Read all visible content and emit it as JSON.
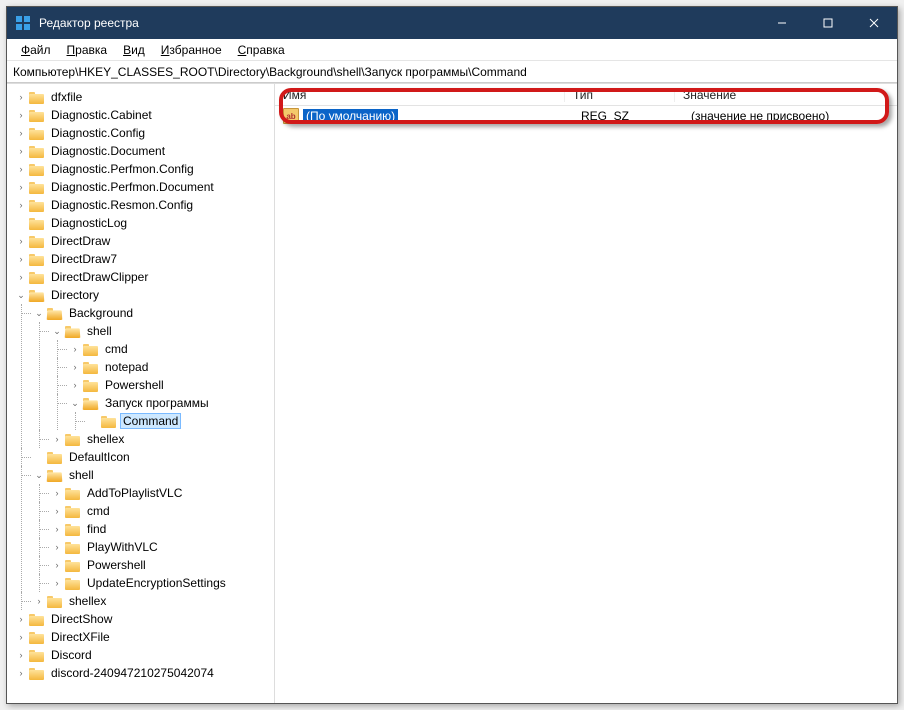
{
  "window": {
    "title": "Редактор реестра"
  },
  "menubar": [
    "Файл",
    "Правка",
    "Вид",
    "Избранное",
    "Справка"
  ],
  "addressbar": "Компьютер\\HKEY_CLASSES_ROOT\\Directory\\Background\\shell\\Запуск программы\\Command",
  "list": {
    "columns": {
      "name": "Имя",
      "type": "Тип",
      "data": "Значение"
    },
    "rows": [
      {
        "name": "(По умолчанию)",
        "type": "REG_SZ",
        "data": "(значение не присвоено)",
        "selected": true
      }
    ]
  },
  "tree": [
    {
      "l": 0,
      "name": "dfxfile",
      "exp": "›"
    },
    {
      "l": 0,
      "name": "Diagnostic.Cabinet",
      "exp": "›"
    },
    {
      "l": 0,
      "name": "Diagnostic.Config",
      "exp": "›"
    },
    {
      "l": 0,
      "name": "Diagnostic.Document",
      "exp": "›"
    },
    {
      "l": 0,
      "name": "Diagnostic.Perfmon.Config",
      "exp": "›"
    },
    {
      "l": 0,
      "name": "Diagnostic.Perfmon.Document",
      "exp": "›"
    },
    {
      "l": 0,
      "name": "Diagnostic.Resmon.Config",
      "exp": "›"
    },
    {
      "l": 0,
      "name": "DiagnosticLog",
      "exp": ""
    },
    {
      "l": 0,
      "name": "DirectDraw",
      "exp": "›"
    },
    {
      "l": 0,
      "name": "DirectDraw7",
      "exp": "›"
    },
    {
      "l": 0,
      "name": "DirectDrawClipper",
      "exp": "›"
    },
    {
      "l": 0,
      "name": "Directory",
      "exp": "⌄",
      "open": true
    },
    {
      "l": 1,
      "name": "Background",
      "exp": "⌄",
      "open": true
    },
    {
      "l": 2,
      "name": "shell",
      "exp": "⌄",
      "open": true
    },
    {
      "l": 3,
      "name": "cmd",
      "exp": "›"
    },
    {
      "l": 3,
      "name": "notepad",
      "exp": "›"
    },
    {
      "l": 3,
      "name": "Powershell",
      "exp": "›"
    },
    {
      "l": 3,
      "name": "Запуск программы",
      "exp": "⌄",
      "open": true
    },
    {
      "l": 4,
      "name": "Command",
      "exp": "",
      "selected": true
    },
    {
      "l": 2,
      "name": "shellex",
      "exp": "›"
    },
    {
      "l": 1,
      "name": "DefaultIcon",
      "exp": ""
    },
    {
      "l": 1,
      "name": "shell",
      "exp": "⌄",
      "open": true
    },
    {
      "l": 2,
      "name": "AddToPlaylistVLC",
      "exp": "›"
    },
    {
      "l": 2,
      "name": "cmd",
      "exp": "›"
    },
    {
      "l": 2,
      "name": "find",
      "exp": "›"
    },
    {
      "l": 2,
      "name": "PlayWithVLC",
      "exp": "›"
    },
    {
      "l": 2,
      "name": "Powershell",
      "exp": "›"
    },
    {
      "l": 2,
      "name": "UpdateEncryptionSettings",
      "exp": "›"
    },
    {
      "l": 1,
      "name": "shellex",
      "exp": "›"
    },
    {
      "l": 0,
      "name": "DirectShow",
      "exp": "›"
    },
    {
      "l": 0,
      "name": "DirectXFile",
      "exp": "›"
    },
    {
      "l": 0,
      "name": "Discord",
      "exp": "›"
    },
    {
      "l": 0,
      "name": "discord-240947210275042074",
      "exp": "›"
    }
  ]
}
